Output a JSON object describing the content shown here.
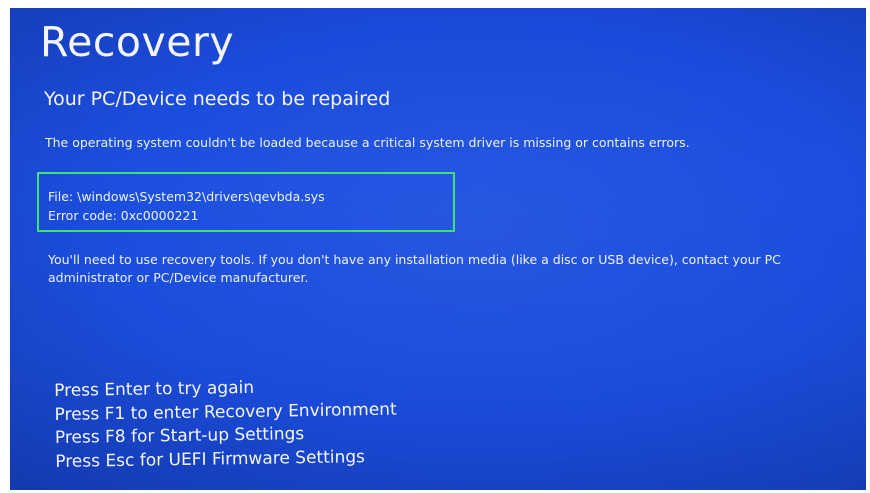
{
  "screen": {
    "title": "Recovery",
    "subtitle": "Your PC/Device needs to be repaired",
    "message": "The operating system couldn't be loaded because a critical system driver is missing or contains errors.",
    "error": {
      "file_line": "File: \\windows\\System32\\drivers\\qevbda.sys",
      "code_line": "Error code: 0xc0000221"
    },
    "tools_message": "You'll need to use recovery tools. If you don't have any installation media (like a disc or USB device), contact your PC administrator or PC/Device manufacturer.",
    "options": [
      "Press Enter to try again",
      "Press F1 to enter Recovery Environment",
      "Press F8 for Start-up Settings",
      "Press Esc for UEFI Firmware Settings"
    ]
  },
  "colors": {
    "background": "#1b4ddb",
    "text": "#ffffff",
    "highlight_border": "#3fe07a",
    "frame": "#ffffff"
  }
}
